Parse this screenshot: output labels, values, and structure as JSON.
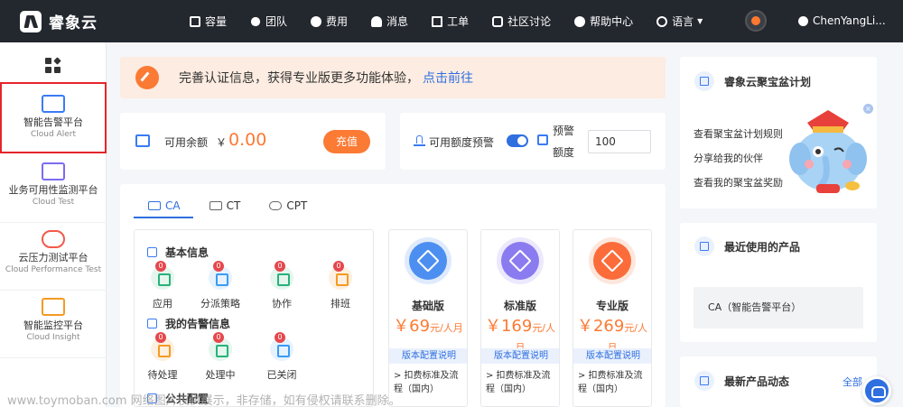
{
  "header": {
    "brand": "睿象云",
    "nav": [
      {
        "icon": "box-icon",
        "label": "容量"
      },
      {
        "icon": "team-icon",
        "label": "团队"
      },
      {
        "icon": "fee-icon",
        "label": "费用"
      },
      {
        "icon": "bell-icon",
        "label": "消息"
      },
      {
        "icon": "ticket-icon",
        "label": "工单"
      },
      {
        "icon": "chat-icon",
        "label": "社区讨论"
      },
      {
        "icon": "help-icon",
        "label": "帮助中心"
      },
      {
        "icon": "globe-icon",
        "label": "语言"
      }
    ],
    "user": "ChenYangLi..."
  },
  "sidebar": {
    "items": [
      {
        "name": "智能告警平台",
        "en": "Cloud Alert",
        "active": true
      },
      {
        "name": "业务可用性监测平台",
        "en": "Cloud Test",
        "active": false
      },
      {
        "name": "云压力测试平台",
        "en": "Cloud Performance Test",
        "active": false
      },
      {
        "name": "智能监控平台",
        "en": "Cloud Insight",
        "active": false
      }
    ]
  },
  "banner": {
    "text": "完善认证信息，获得专业版更多功能体验，",
    "link": "点击前往"
  },
  "balance": {
    "label": "可用余额",
    "currency": "￥",
    "amount": "0.00",
    "recharge": "充值"
  },
  "alert": {
    "label": "可用额度预警",
    "toggle_on": true,
    "quota_label": "预警额度",
    "quota_value": "100"
  },
  "tabs": [
    {
      "label": "CA",
      "active": true
    },
    {
      "label": "CT",
      "active": false
    },
    {
      "label": "CPT",
      "active": false
    }
  ],
  "basic_info": {
    "title": "基本信息",
    "items": [
      {
        "label": "应用",
        "badge": "0",
        "color": "#27b27a",
        "bg": "#e5f6ee"
      },
      {
        "label": "分派策略",
        "badge": "0",
        "color": "#3a9bf5",
        "bg": "#e6f2fe"
      },
      {
        "label": "协作",
        "badge": "0",
        "color": "#27b27a",
        "bg": "#e5f6ee"
      },
      {
        "label": "排班",
        "badge": "0",
        "color": "#f59a23",
        "bg": "#fdf0e0"
      }
    ],
    "my_alerts_title": "我的告警信息",
    "alerts": [
      {
        "label": "待处理",
        "badge": "0",
        "color": "#f59a23",
        "bg": "#fdf0e0"
      },
      {
        "label": "处理中",
        "badge": "0",
        "color": "#27b27a",
        "bg": "#e5f6ee"
      },
      {
        "label": "已关闭",
        "badge": "0",
        "color": "#3a9bf5",
        "bg": "#e6f2fe"
      }
    ],
    "public_config_title": "公共配置"
  },
  "plans": [
    {
      "name": "基础版",
      "price": "￥69",
      "unit": "元/人月",
      "color": "#4d8ff0",
      "ring": "#dfeafc",
      "config": "版本配置说明",
      "desc": "> 扣费标准及流程（国内）"
    },
    {
      "name": "标准版",
      "price": "￥169",
      "unit": "元/人月",
      "color": "#8b7bf0",
      "ring": "#ece8fd",
      "config": "版本配置说明",
      "desc": "> 扣费标准及流程（国内）"
    },
    {
      "name": "专业版",
      "price": "￥269",
      "unit": "元/人月",
      "color": "#fb6c3a",
      "ring": "#fde6dc",
      "config": "版本配置说明",
      "desc": "> 扣费标准及流程（国内）"
    }
  ],
  "treasure": {
    "title": "睿象云聚宝盆计划",
    "links": [
      "查看聚宝盆计划规则",
      "分享给我的伙伴",
      "查看我的聚宝盆奖励"
    ]
  },
  "recent": {
    "title": "最近使用的产品",
    "item": "CA（智能告警平台）"
  },
  "news": {
    "title": "最新产品动态",
    "more": "全部"
  },
  "watermark": "www.toymoban.com 网络图片仅供展示，非存储，如有侵权请联系删除。"
}
